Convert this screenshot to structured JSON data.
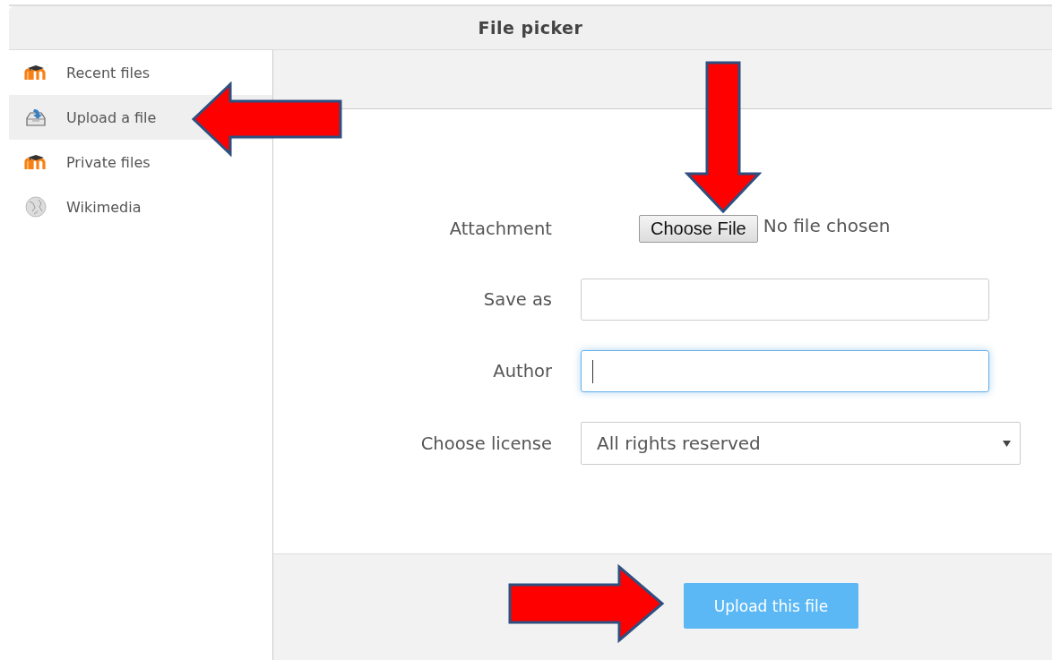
{
  "window": {
    "title": "File picker"
  },
  "sidebar": {
    "items": [
      {
        "label": "Recent files",
        "kind": "moodle",
        "selected": false
      },
      {
        "label": "Upload a file",
        "kind": "upload",
        "selected": true
      },
      {
        "label": "Private files",
        "kind": "moodle",
        "selected": false
      },
      {
        "label": "Wikimedia",
        "kind": "globe",
        "selected": false
      }
    ]
  },
  "form": {
    "file": {
      "label": "Attachment",
      "button": "Choose File",
      "status": "No file chosen"
    },
    "fields": [
      {
        "label": "Save as",
        "kind": "text",
        "focused": false
      },
      {
        "label": "Author",
        "kind": "text",
        "focused": true
      },
      {
        "label": "Choose license",
        "kind": "select",
        "value": "All rights reserved"
      }
    ]
  },
  "footer": {
    "button": "Upload this file"
  },
  "callout_arrows": [
    {
      "kind": "left"
    },
    {
      "kind": "down"
    },
    {
      "kind": "right"
    }
  ]
}
